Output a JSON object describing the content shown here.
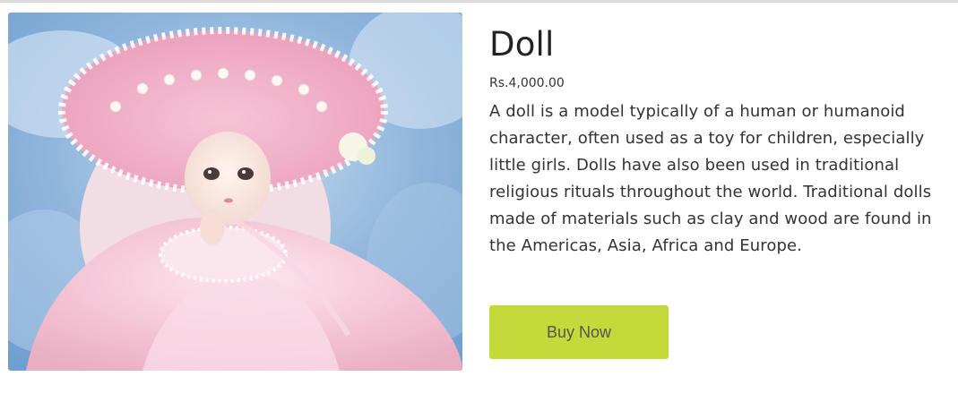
{
  "product": {
    "name": "Doll",
    "price": "Rs.4,000.00",
    "description": "A doll is a model typically of a human or humanoid character, often used as a toy for children, especially little girls. Dolls have also been used in traditional religious rituals throughout the world. Traditional dolls made of materials such as clay and wood are found in the Americas, Asia, Africa and Europe.",
    "image_icon": "doll-photo"
  },
  "actions": {
    "buy_label": "Buy Now"
  },
  "colors": {
    "buy_button": "#c4d93a",
    "title_text": "#222222"
  }
}
